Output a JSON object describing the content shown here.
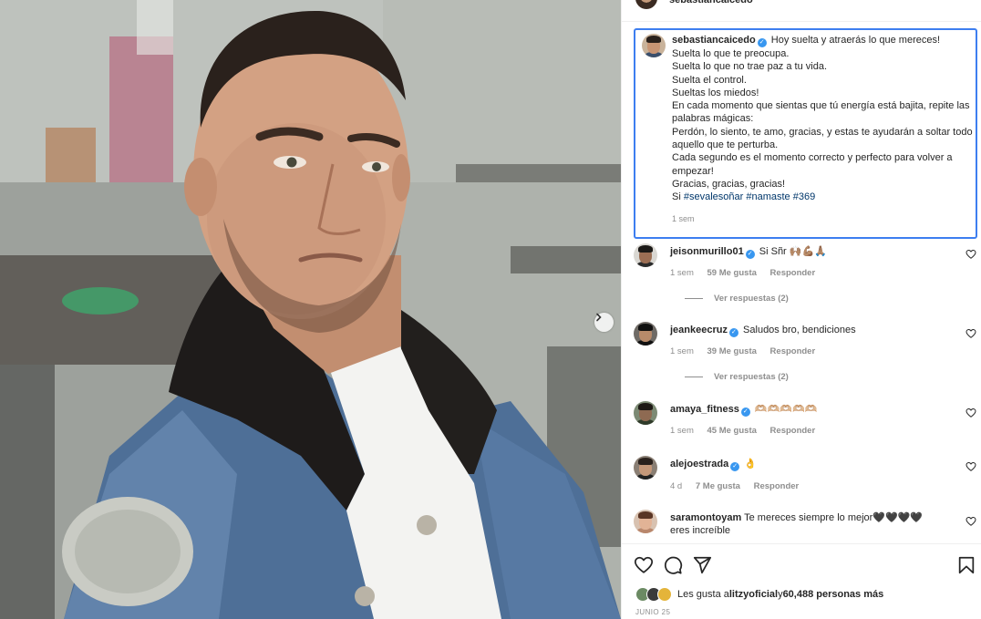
{
  "post": {
    "author": "sebastiancaicedo",
    "caption_lines": [
      "Hoy suelta y atraerás lo que mereces!",
      "Suelta lo que te preocupa.",
      "Suelta lo que no trae paz a tu vida.",
      "Suelta el control.",
      "Sueltas los miedos!",
      "En cada momento que sientas que tú energía está bajita, repite las palabras mágicas:",
      "Perdón, lo siento, te amo, gracias, y estas te ayudarán a soltar todo aquello que te perturba.",
      "Cada segundo es el momento correcto y perfecto para volver a empezar!",
      "Gracias, gracias, gracias!"
    ],
    "caption_last_prefix": "Si ",
    "hashtags": [
      "#sevalesoñar",
      "#namaste",
      "#369"
    ],
    "time": "1 sem",
    "accent_color": "#3d7ef0"
  },
  "comments": [
    {
      "username": "jeisonmurillo01",
      "verified": true,
      "text": "Si Sñr 🙌🏽💪🏽🙏🏽",
      "time": "1 sem",
      "likes": "59 Me gusta",
      "reply": "Responder",
      "replies": "Ver respuestas (2)"
    },
    {
      "username": "jeankeecruz",
      "verified": true,
      "text": "Saludos bro, bendiciones",
      "time": "1 sem",
      "likes": "39 Me gusta",
      "reply": "Responder",
      "replies": "Ver respuestas (2)"
    },
    {
      "username": "amaya_fitness",
      "verified": true,
      "text": "🫶🏼🫶🏼🫶🏼🫶🏼🫶🏼",
      "time": "1 sem",
      "likes": "45 Me gusta",
      "reply": "Responder"
    },
    {
      "username": "alejoestrada",
      "verified": true,
      "text": "👌",
      "time": "4 d",
      "likes": "7 Me gusta",
      "reply": "Responder"
    },
    {
      "username": "saramontoyam",
      "verified": false,
      "text": "Te mereces siempre lo mejor🖤🖤🖤🖤 eres increíble"
    }
  ],
  "likes": {
    "prefix": "Les gusta a ",
    "user": "litzyoficial",
    "middle": " y ",
    "count": "60,488 personas más"
  },
  "date": "JUNIO 25",
  "icons": [
    "heart-icon",
    "comment-icon",
    "share-icon",
    "bookmark-icon",
    "chevron-right-icon",
    "verified-badge-icon"
  ]
}
